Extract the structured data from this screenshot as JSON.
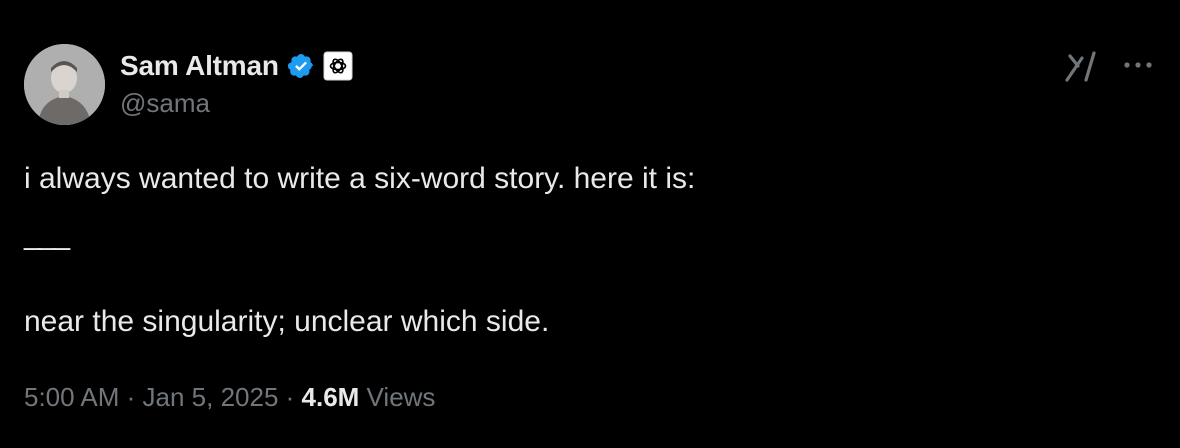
{
  "author": {
    "name": "Sam Altman",
    "handle": "@sama",
    "verified": true
  },
  "icons": {
    "verified": "verified-badge-icon",
    "affiliation": "openai-logo-icon",
    "grok": "grok-icon",
    "more": "more-options-icon"
  },
  "tweet": {
    "line1": "i always wanted to write a six-word story. here it is:",
    "line2": "___",
    "line3": "near the singularity; unclear which side."
  },
  "meta": {
    "time": "5:00 AM",
    "separator1": " · ",
    "date": "Jan 5, 2025",
    "separator2": " · ",
    "views_count": "4.6M",
    "views_label": " Views"
  },
  "colors": {
    "background": "#000000",
    "text": "#e7e9ea",
    "secondary": "#71767b",
    "verified_blue": "#1d9bf0"
  }
}
